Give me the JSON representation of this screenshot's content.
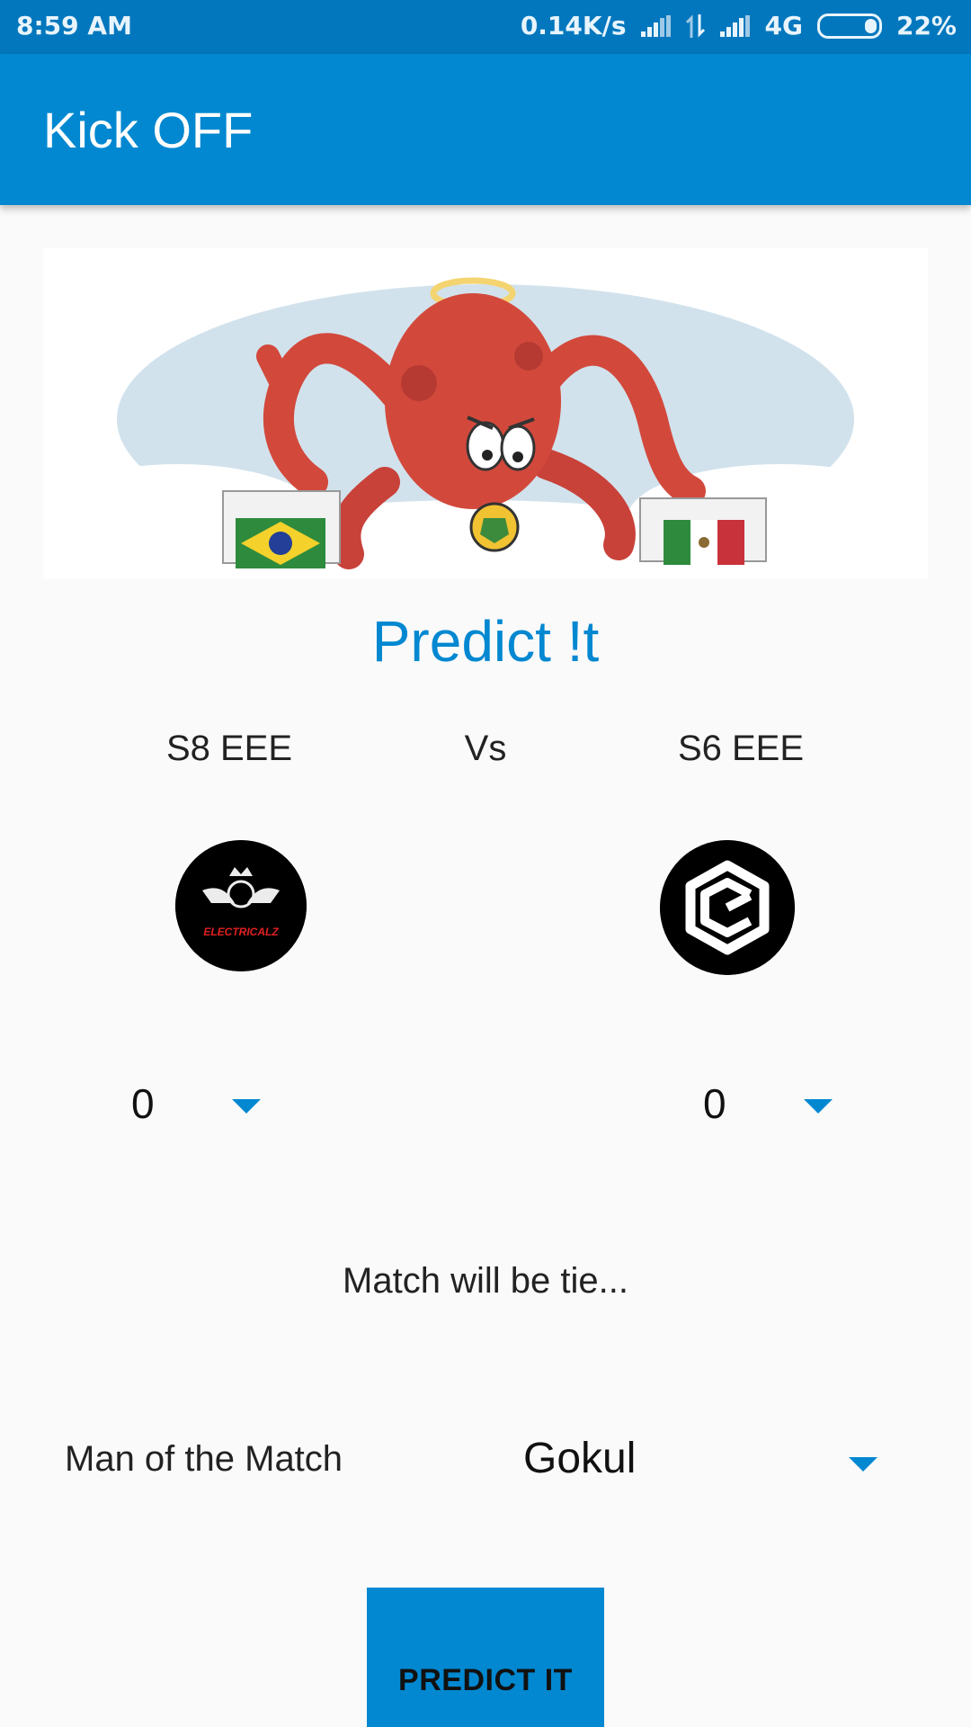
{
  "status_bar": {
    "time": "8:59 AM",
    "network_speed": "0.14K/s",
    "network_type": "4G",
    "battery": "22%",
    "battery_level": 0.22,
    "icons": [
      "signal-icon",
      "data-transfer-icon",
      "signal-icon",
      "battery-icon"
    ]
  },
  "app_bar": {
    "title": "Kick OFF"
  },
  "banner": {
    "image": "octopus-predicting-brazil-vs-mexico"
  },
  "predict": {
    "title": "Predict !t",
    "team_a": {
      "name": "S8 EEE",
      "logo": "electricalz-logo",
      "logo_text": "ELECTRICALZ"
    },
    "vs": "Vs",
    "team_b": {
      "name": "S6 EEE",
      "logo": "cube-logo"
    },
    "score_a": "0",
    "score_b": "0",
    "result": "Match will be tie...",
    "motm_label": "Man of the Match",
    "motm_value": "Gokul",
    "button_label": "PREDICT IT"
  },
  "colors": {
    "primary": "#0288d1",
    "primary_dark": "#0277bd",
    "background": "#fafafa"
  }
}
